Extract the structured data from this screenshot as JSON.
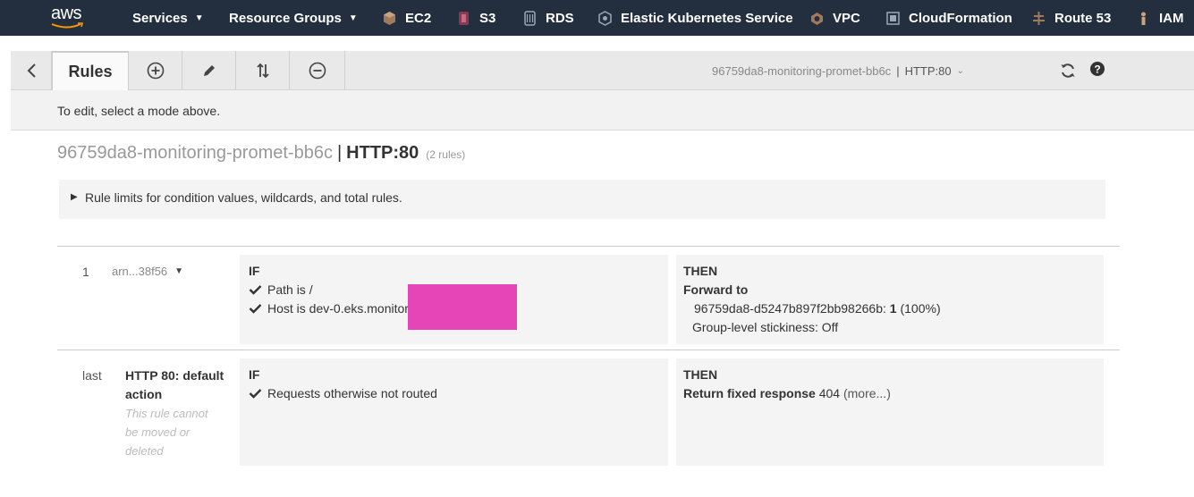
{
  "topnav": {
    "logo": "aws",
    "services": "Services",
    "resource_groups": "Resource Groups",
    "links": [
      {
        "label": "EC2",
        "icon": "ec2-icon"
      },
      {
        "label": "S3",
        "icon": "s3-icon"
      },
      {
        "label": "RDS",
        "icon": "rds-icon"
      },
      {
        "label": "Elastic Kubernetes Service",
        "icon": "eks-icon"
      },
      {
        "label": "VPC",
        "icon": "vpc-icon"
      },
      {
        "label": "CloudFormation",
        "icon": "cloudformation-icon"
      },
      {
        "label": "Route 53",
        "icon": "route53-icon"
      },
      {
        "label": "IAM",
        "icon": "iam-icon"
      }
    ]
  },
  "toolbar": {
    "rules_tab": "Rules",
    "load_balancer": "96759da8-monitoring-promet-bb6c",
    "separator": "|",
    "listener": "HTTP:80"
  },
  "hint": "To edit, select a mode above.",
  "heading": {
    "load_balancer": "96759da8-monitoring-promet-bb6c",
    "separator": "|",
    "listener": "HTTP:80",
    "count": "(2 rules)"
  },
  "limits": "Rule limits for condition values, wildcards, and total rules.",
  "rules": [
    {
      "number": "1",
      "arn": "arn...38f56",
      "if_label": "IF",
      "conditions": [
        "Path is /",
        "Host is dev-0.eks.monitor"
      ],
      "then_label": "THEN",
      "action_title": "Forward to",
      "target_group": "96759da8-d5247b897f2bb98266b",
      "target_sep": ":",
      "weight": "1",
      "weight_pct": "(100%)",
      "stickiness": "Group-level stickiness: Off"
    },
    {
      "number": "last",
      "name": "HTTP 80: default action",
      "note": "This rule cannot be moved or deleted",
      "if_label": "IF",
      "conditions": [
        "Requests otherwise not routed"
      ],
      "then_label": "THEN",
      "action_title": "Return fixed response",
      "action_code": "404",
      "more": "(more...)"
    }
  ],
  "colors": {
    "nav_bg": "#232f3e",
    "toolbar_bg": "#e9e9e9",
    "panel_bg": "#f4f4f4",
    "redaction": "#e645b8"
  }
}
